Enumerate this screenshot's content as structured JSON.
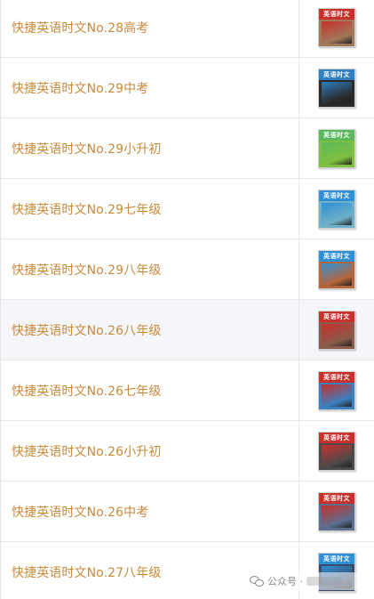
{
  "items": [
    {
      "title": "快捷英语时文No.28高考",
      "cover_text": "英语时文",
      "cover_colors": [
        "#c9302c",
        "#a0785a"
      ]
    },
    {
      "title": "快捷英语时文No.29中考",
      "cover_text": "英语时文",
      "cover_colors": [
        "#2d7fc1",
        "#2a2a2a"
      ]
    },
    {
      "title": "快捷英语时文No.29小升初",
      "cover_text": "英语时文",
      "cover_colors": [
        "#5cb85c",
        "#7fbf3f"
      ]
    },
    {
      "title": "快捷英语时文No.29七年级",
      "cover_text": "英语时文",
      "cover_colors": [
        "#2d8fd5",
        "#6fb0c8"
      ]
    },
    {
      "title": "快捷英语时文No.29八年级",
      "cover_text": "英语时文",
      "cover_colors": [
        "#2d8fd5",
        "#b5653a"
      ]
    },
    {
      "title": "快捷英语时文No.26八年级",
      "cover_text": "英语时文",
      "cover_colors": [
        "#c9302c",
        "#8a5a4a"
      ]
    },
    {
      "title": "快捷英语时文No.26七年级",
      "cover_text": "英语时文",
      "cover_colors": [
        "#c9302c",
        "#3a7fbf"
      ]
    },
    {
      "title": "快捷英语时文No.26小升初",
      "cover_text": "英语时文",
      "cover_colors": [
        "#c9302c",
        "#4a4a4a"
      ]
    },
    {
      "title": "快捷英语时文No.26中考",
      "cover_text": "英语时文",
      "cover_colors": [
        "#c9302c",
        "#5a6f8f"
      ]
    },
    {
      "title": "快捷英语时文No.27八年级",
      "cover_text": "英语时文",
      "cover_colors": [
        "#2d8fd5",
        "#3a4a6a"
      ]
    }
  ],
  "active_index": 5,
  "watermark": {
    "label": "公众号 ·",
    "icon": "wechat-icon"
  }
}
